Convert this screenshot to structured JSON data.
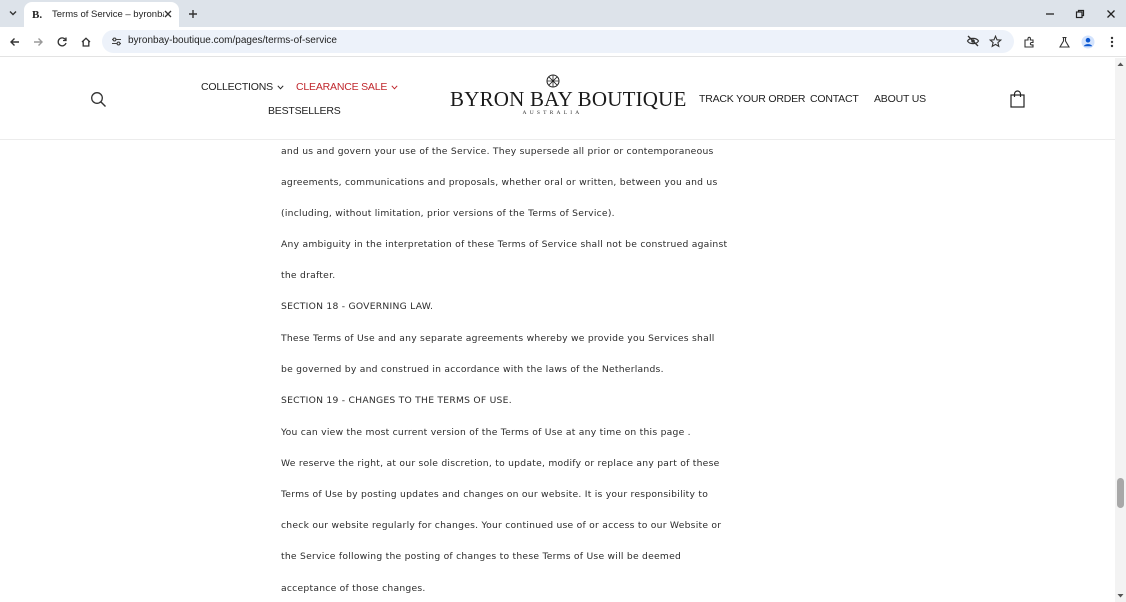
{
  "browser": {
    "tab_title": "Terms of Service – byronbay-boutique",
    "favicon_letter": "B.",
    "url": "byronbay-boutique.com/pages/terms-of-service"
  },
  "header": {
    "nav_left": [
      {
        "label": "COLLECTIONS",
        "has_dropdown": true
      },
      {
        "label": "CLEARANCE SALE",
        "has_dropdown": true,
        "color": "#c0272d"
      },
      {
        "label": "BESTSELLERS",
        "has_dropdown": false
      }
    ],
    "logo_text": "BYRON BAY BOUTIQUE",
    "logo_sub": "AUSTRALIA",
    "nav_right": [
      {
        "label": "TRACK YOUR ORDER"
      },
      {
        "label": "CONTACT"
      },
      {
        "label": "ABOUT US"
      }
    ]
  },
  "content": {
    "lines": [
      "and us and govern your use of the Service. They supersede all prior or contemporaneous",
      "agreements, communications and proposals, whether oral or written, between you and us",
      "(including, without limitation, prior versions of the Terms of Service).",
      "Any ambiguity in the interpretation of these Terms of Service shall not be construed against",
      "the drafter.",
      "SECTION 18 - GOVERNING LAW.",
      "These Terms of Use and any separate agreements whereby we provide you Services shall",
      "be governed by and construed in accordance with the laws of the Netherlands.",
      "SECTION 19 - CHANGES TO THE TERMS OF USE.",
      "You can view the most current version of the Terms of Use at any time on this page .",
      "We reserve the right, at our sole discretion, to update, modify or replace any part of these",
      "Terms of Use by posting updates and changes on our website. It is your responsibility to",
      "check our website regularly for changes. Your continued use of or access to our Website or",
      "the Service following the posting of changes to these Terms of Use will be deemed",
      "acceptance of those changes."
    ]
  },
  "colors": {
    "tabstrip": "#dde3ea",
    "omnibox": "#edf2fa",
    "sale_red": "#c0272d",
    "body_text": "#2b2b2b"
  }
}
